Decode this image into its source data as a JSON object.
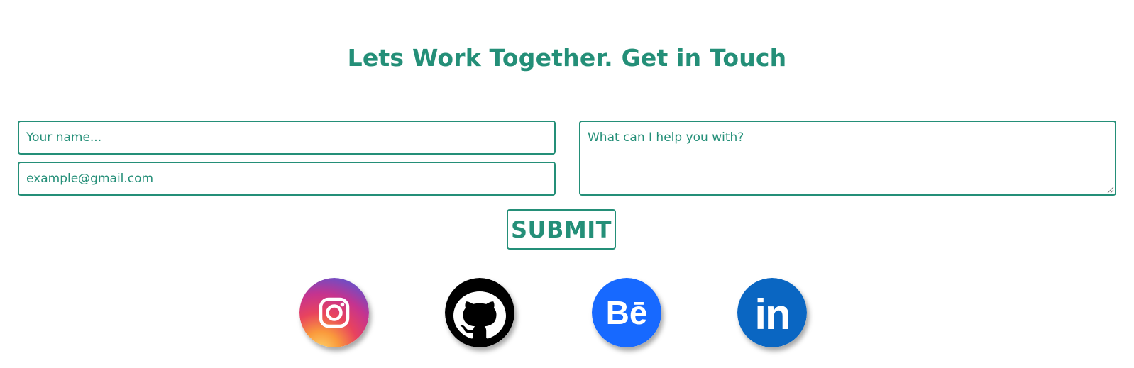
{
  "contact": {
    "heading": "Lets Work Together. Get in Touch",
    "name_placeholder": "Your name...",
    "email_placeholder": "example@gmail.com",
    "message_placeholder": "What can I help you with?",
    "submit_label": "SUBMIT"
  },
  "social_links": [
    {
      "icon": "instagram-icon"
    },
    {
      "icon": "github-icon"
    },
    {
      "icon": "behance-icon",
      "text": "Bē"
    },
    {
      "icon": "linkedin-icon",
      "text": "in"
    }
  ],
  "colors": {
    "accent": "#248f78",
    "background": "#ffffff",
    "behance": "#1769ff",
    "linkedin": "#0a66c2",
    "github": "#000000"
  }
}
